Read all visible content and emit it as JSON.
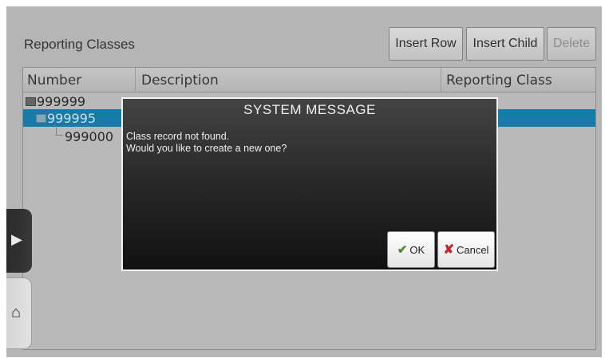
{
  "panel": {
    "title": "Reporting Classes",
    "buttons": {
      "insert_row": "Insert Row",
      "insert_child": "Insert Child",
      "delete": "Delete"
    }
  },
  "grid": {
    "columns": [
      "Number",
      "Description",
      "Reporting Class"
    ],
    "rows": [
      {
        "number": "999999",
        "selected": false
      },
      {
        "number": "999995",
        "selected": true
      },
      {
        "number": "999000",
        "selected": false
      }
    ]
  },
  "side_tabs": {
    "expand_icon": "play-arrow-icon",
    "home_icon": "home-icon"
  },
  "dialog": {
    "title": "SYSTEM MESSAGE",
    "line1": "Class record not found.",
    "line2": "Would you like to create a new one?",
    "ok_label": "OK",
    "cancel_label": "Cancel"
  },
  "colors": {
    "selection": "#1a86b8",
    "dialog_bg": "#1f1f1f"
  }
}
